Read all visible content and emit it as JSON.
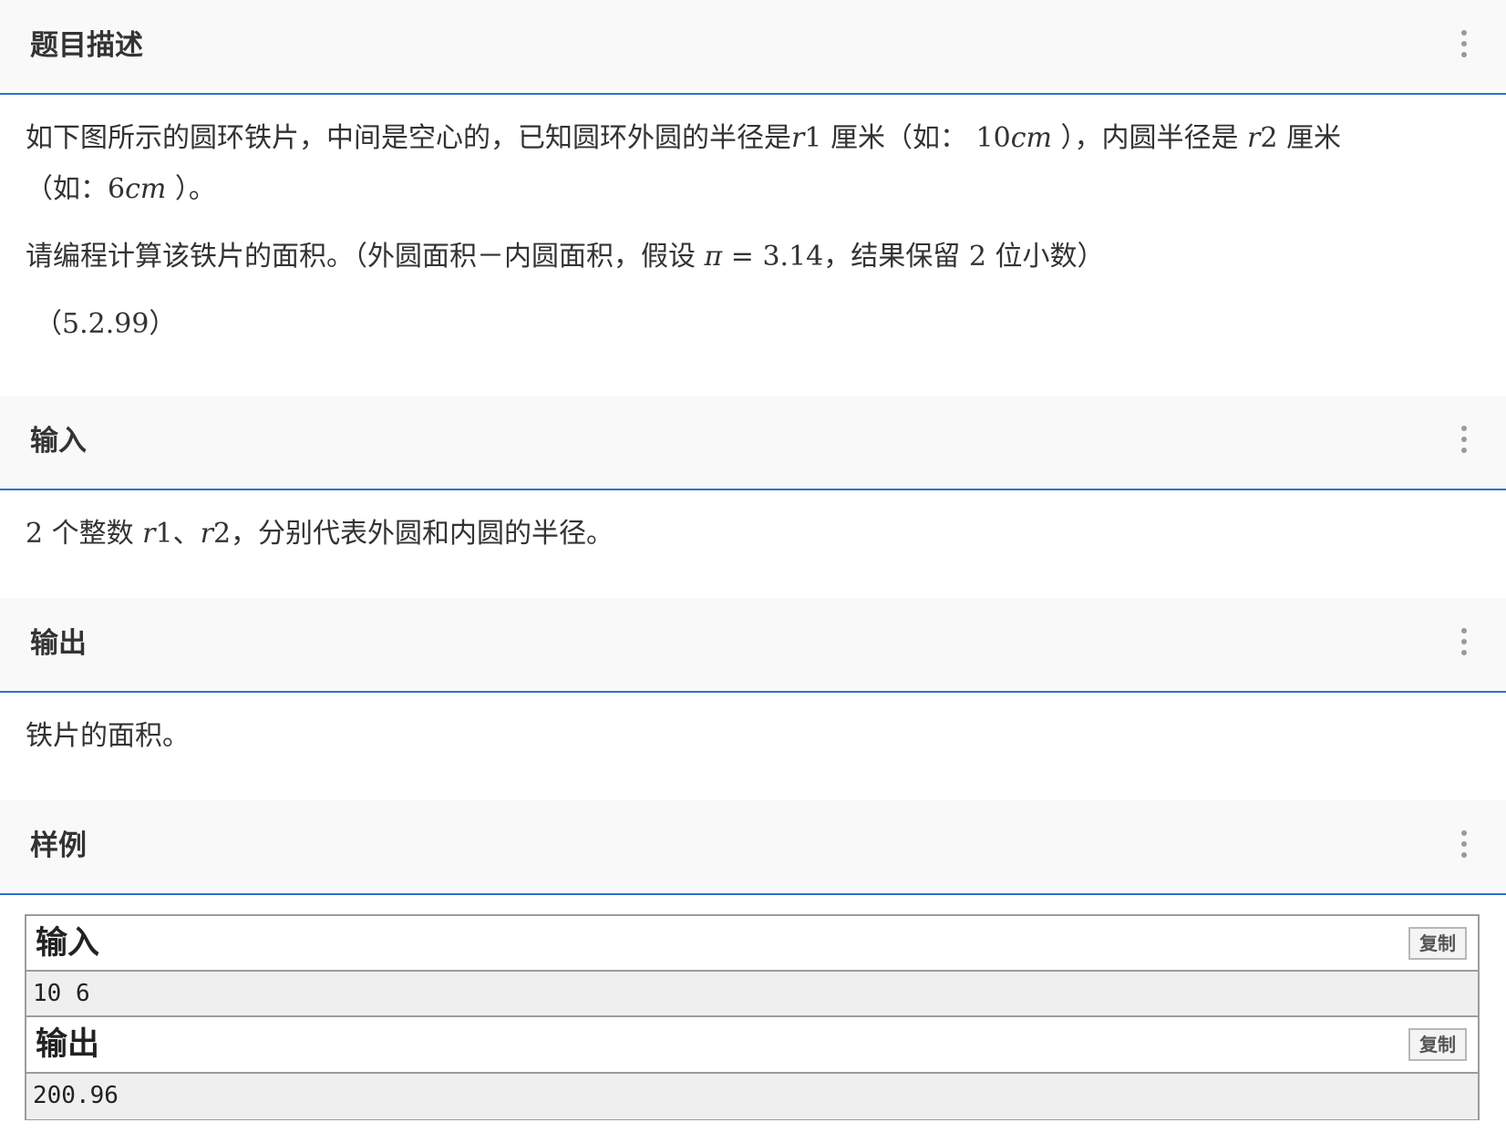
{
  "sections": {
    "description": {
      "title": "题目描述",
      "line1": {
        "t1": "如下图所示的圆环铁片，中间是空心的，已知圆环外圆的半径是",
        "m1": "r",
        "m1n": "1",
        "t2": " 厘米（如： ",
        "m2": "10",
        "m2i": "cm",
        "t3": " ），内圆半径是 ",
        "m3": "r",
        "m3n": "2",
        "t4": " 厘米"
      },
      "line2": {
        "t1": "（如：",
        "m1": "6",
        "m1i": "cm",
        "t2": " ）。"
      },
      "line3": {
        "t1": "请编程计算该铁片的面积。（外圆面积－内圆面积，假设 ",
        "m1": "π",
        "m2": " = 3.14",
        "t2": "，结果保留 ",
        "m3": "2",
        "t3": " 位小数）"
      },
      "line4": {
        "m1": "（5.2.99）"
      }
    },
    "input": {
      "title": "输入",
      "t1": "2",
      "t2": " 个整数 ",
      "m1": "r",
      "m1n": "1",
      "t3": "、",
      "m2": "r",
      "m2n": "2",
      "t4": "，分别代表外圆和内圆的半径。"
    },
    "output": {
      "title": "输出",
      "text": "铁片的面积。"
    },
    "sample": {
      "title": "样例",
      "input_label": "输入",
      "input_value": "10 6",
      "output_label": "输出",
      "output_value": "200.96",
      "copy_label": "复制"
    }
  },
  "colors": {
    "accent": "#2f6fd6",
    "header_bg": "#f9f9f9",
    "sample_bg": "#efefef"
  },
  "icons": {
    "more": "more-vertical-icon"
  }
}
